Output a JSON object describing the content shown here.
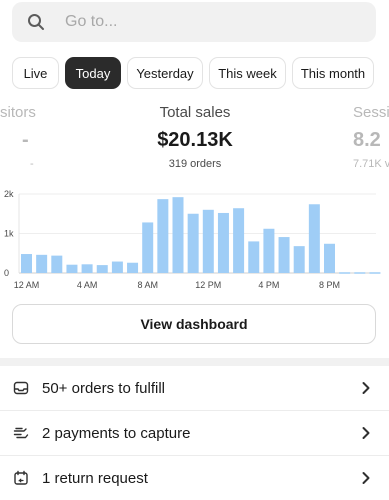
{
  "search": {
    "placeholder": "Go to..."
  },
  "tabs": [
    "Live",
    "Today",
    "Yesterday",
    "This week",
    "This month"
  ],
  "active_tab": "Today",
  "metrics": [
    {
      "label": "Visitors",
      "visible_label": "sitors",
      "value": "-",
      "sub": "-"
    },
    {
      "label": "Total sales",
      "value": "$20.13K",
      "sub": "319 orders"
    },
    {
      "label": "Sessions",
      "visible_label": "Sessi",
      "value": "8.2",
      "sub": "7.71K v"
    }
  ],
  "chart_data": {
    "type": "bar",
    "title": "",
    "xlabel": "",
    "ylabel": "",
    "ylim": [
      0,
      2000
    ],
    "y_ticks": [
      "0",
      "1k",
      "2k"
    ],
    "x_tick_labels": [
      "12 AM",
      "4 AM",
      "8 AM",
      "12 PM",
      "4 PM",
      "8 PM"
    ],
    "values": [
      480,
      460,
      440,
      210,
      220,
      200,
      290,
      260,
      1280,
      1870,
      1920,
      1500,
      1600,
      1520,
      1640,
      800,
      1120,
      910,
      680,
      1740,
      740,
      0,
      0,
      0
    ],
    "color": "#9fcdf6"
  },
  "dashboard_button": "View dashboard",
  "action_rows": [
    {
      "icon": "inbox-icon",
      "label": "50+ orders to fulfill"
    },
    {
      "icon": "payment-icon",
      "label": "2 payments to capture"
    },
    {
      "icon": "return-icon",
      "label": "1 return request"
    }
  ]
}
